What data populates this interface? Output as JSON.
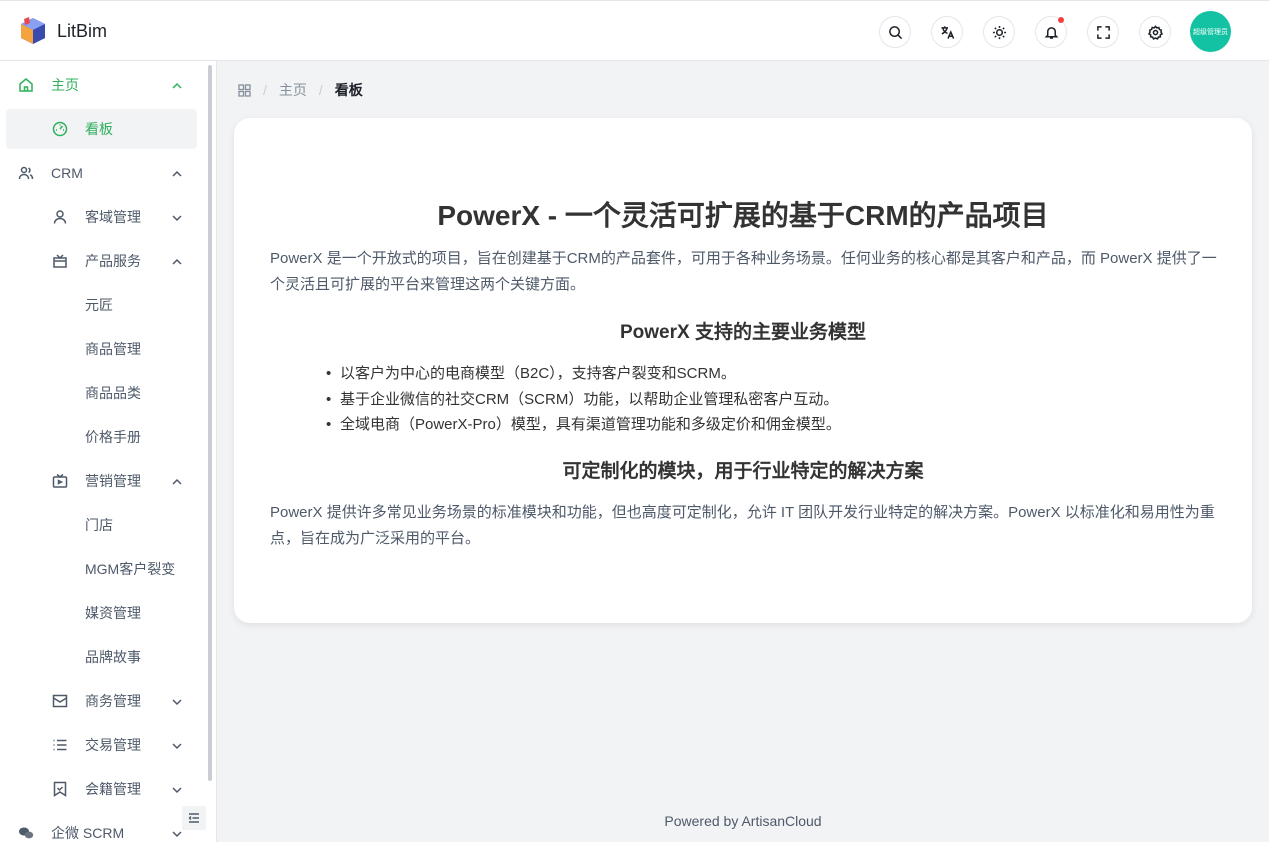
{
  "header": {
    "brand": "LitBim",
    "avatar_text": "超级管理员",
    "icons": [
      "search-icon",
      "translate-icon",
      "theme-icon",
      "bell-icon",
      "fullscreen-icon",
      "settings-icon"
    ]
  },
  "sidebar": {
    "home": "主页",
    "dashboard": "看板",
    "crm": "CRM",
    "customer_domain": "客域管理",
    "product_service": "产品服务",
    "yuanjiang": "元匠",
    "product_mgmt": "商品管理",
    "product_category": "商品品类",
    "price_book": "价格手册",
    "marketing": "营销管理",
    "store": "门店",
    "mgm": "MGM客户裂变",
    "media": "媒资管理",
    "brand_story": "品牌故事",
    "business": "商务管理",
    "trade": "交易管理",
    "membership": "会籍管理",
    "wecom_scrm": "企微 SCRM"
  },
  "breadcrumb": {
    "home": "主页",
    "current": "看板"
  },
  "content": {
    "title": "PowerX - 一个灵活可扩展的基于CRM的产品项目",
    "intro": "PowerX 是一个开放式的项目，旨在创建基于CRM的产品套件，可用于各种业务场景。任何业务的核心都是其客户和产品，而 PowerX 提供了一个灵活且可扩展的平台来管理这两个关键方面。",
    "models_heading": "PowerX 支持的主要业务模型",
    "models": [
      "以客户为中心的电商模型（B2C），支持客户裂变和SCRM。",
      "基于企业微信的社交CRM（SCRM）功能，以帮助企业管理私密客户互动。",
      "全域电商（PowerX-Pro）模型，具有渠道管理功能和多级定价和佣金模型。"
    ],
    "modules_heading": "可定制化的模块，用于行业特定的解决方案",
    "modules_text": "PowerX 提供许多常见业务场景的标准模块和功能，但也高度可定制化，允许 IT 团队开发行业特定的解决方案。PowerX 以标准化和易用性为重点，旨在成为广泛采用的平台。"
  },
  "footer": "Powered by ArtisanCloud",
  "colors": {
    "accent": "#2fb05a",
    "avatar": "#13c2a3",
    "notification_dot": "#f53f3f"
  }
}
